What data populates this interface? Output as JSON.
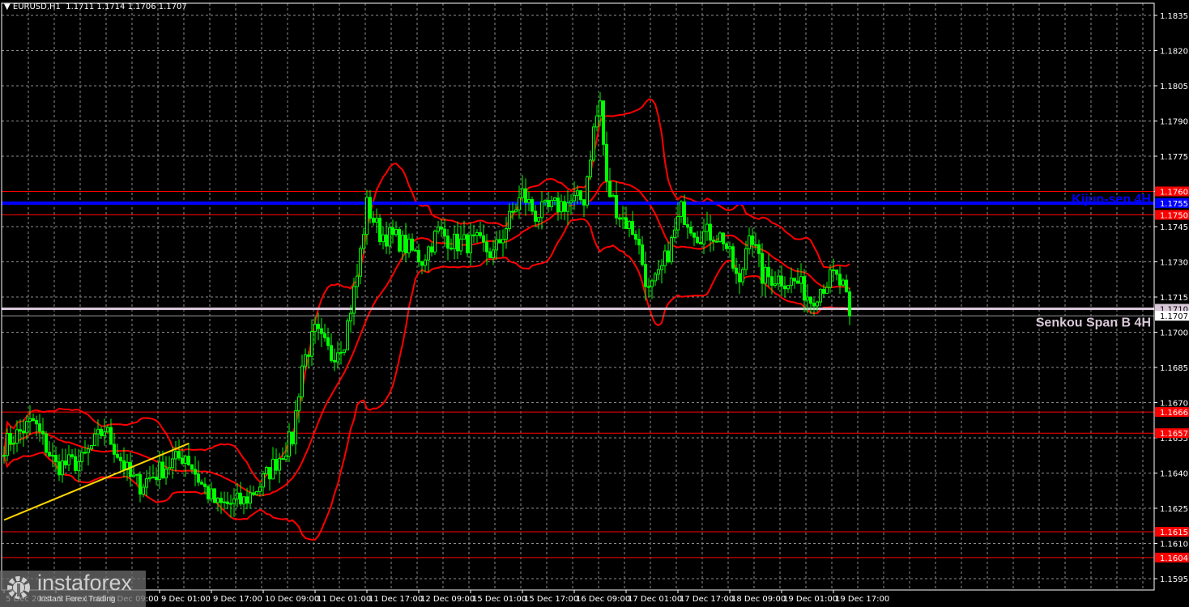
{
  "header": {
    "symbol": "EURUSD,H1",
    "ohlc": "1.1711 1.1714 1.1706 1.1707"
  },
  "watermark": {
    "brand": "instaforex",
    "tagline": "Instant Forex Trading"
  },
  "colors": {
    "candle": "#00ff00",
    "bands": "#ff0000",
    "kijun": "#0000ff",
    "senkou": "#d8c8d8",
    "trend": "#ffd700",
    "grid": "#8c8c8c"
  },
  "chart_data": {
    "type": "candlestick",
    "title": "EURUSD,H1",
    "ylim": [
      1.1588,
      1.1842
    ],
    "y_ticks": [
      1.1835,
      1.182,
      1.1805,
      1.179,
      1.1775,
      1.176,
      1.1745,
      1.173,
      1.1715,
      1.17,
      1.1685,
      1.167,
      1.1655,
      1.164,
      1.1625,
      1.161,
      1.1595
    ],
    "x_ticks": [
      {
        "bar": 0,
        "label": "5 Dec 2025"
      },
      {
        "bar": 16,
        "label": "5 Dec 17:00"
      },
      {
        "bar": 32,
        "label": "8 Dec 09:00"
      },
      {
        "bar": 48,
        "label": "9 Dec 01:00"
      },
      {
        "bar": 64,
        "label": "9 Dec 17:00"
      },
      {
        "bar": 80,
        "label": "10 Dec 09:00"
      },
      {
        "bar": 96,
        "label": "11 Dec 01:00"
      },
      {
        "bar": 112,
        "label": "11 Dec 17:00"
      },
      {
        "bar": 128,
        "label": "12 Dec 09:00"
      },
      {
        "bar": 144,
        "label": "15 Dec 01:00"
      },
      {
        "bar": 160,
        "label": "15 Dec 17:00"
      },
      {
        "bar": 176,
        "label": "16 Dec 09:00"
      },
      {
        "bar": 192,
        "label": "17 Dec 01:00"
      },
      {
        "bar": 208,
        "label": "17 Dec 17:00"
      },
      {
        "bar": 224,
        "label": "18 Dec 09:00"
      },
      {
        "bar": 240,
        "label": "19 Dec 01:00"
      },
      {
        "bar": 256,
        "label": "19 Dec 17:00"
      }
    ],
    "close_path": [
      [
        0,
        1.1652
      ],
      [
        9,
        1.1662
      ],
      [
        16,
        1.1643
      ],
      [
        24,
        1.1645
      ],
      [
        31,
        1.1659
      ],
      [
        39,
        1.1638
      ],
      [
        42,
        1.1635
      ],
      [
        49,
        1.1642
      ],
      [
        56,
        1.1648
      ],
      [
        61,
        1.1635
      ],
      [
        66,
        1.1626
      ],
      [
        74,
        1.1628
      ],
      [
        79,
        1.1635
      ],
      [
        84,
        1.1645
      ],
      [
        89,
        1.1655
      ],
      [
        92,
        1.1686
      ],
      [
        96,
        1.17
      ],
      [
        101,
        1.169
      ],
      [
        105,
        1.1697
      ],
      [
        109,
        1.1724
      ],
      [
        112,
        1.1754
      ],
      [
        116,
        1.1742
      ],
      [
        121,
        1.174
      ],
      [
        129,
        1.1731
      ],
      [
        134,
        1.1743
      ],
      [
        139,
        1.1738
      ],
      [
        146,
        1.1738
      ],
      [
        151,
        1.1733
      ],
      [
        156,
        1.1748
      ],
      [
        160,
        1.1759
      ],
      [
        164,
        1.175
      ],
      [
        171,
        1.1754
      ],
      [
        179,
        1.1757
      ],
      [
        182,
        1.1786
      ],
      [
        184,
        1.1798
      ],
      [
        186,
        1.1762
      ],
      [
        190,
        1.175
      ],
      [
        195,
        1.1742
      ],
      [
        199,
        1.1717
      ],
      [
        202,
        1.1723
      ],
      [
        206,
        1.1738
      ],
      [
        209,
        1.1752
      ],
      [
        214,
        1.1742
      ],
      [
        219,
        1.1742
      ],
      [
        222,
        1.174
      ],
      [
        225,
        1.1728
      ],
      [
        227,
        1.1719
      ],
      [
        230,
        1.1745
      ],
      [
        234,
        1.1724
      ],
      [
        239,
        1.1723
      ],
      [
        245,
        1.1721
      ],
      [
        249,
        1.1714
      ],
      [
        252,
        1.1719
      ],
      [
        256,
        1.1724
      ],
      [
        259,
        1.1719
      ],
      [
        261,
        1.1707
      ]
    ],
    "levels": [
      {
        "price": 1.176,
        "label": "1.1760",
        "kind": "resistance"
      },
      {
        "price": 1.1755,
        "label": "1.1755",
        "kind": "kijun",
        "name": "Kijun-sen 4H"
      },
      {
        "price": 1.175,
        "label": "1.1750",
        "kind": "resistance"
      },
      {
        "price": 1.171,
        "label": "1.1710",
        "kind": "senkou",
        "name": "Senkou Span B 4H"
      },
      {
        "price": 1.1707,
        "label": "1.1707",
        "kind": "bid"
      },
      {
        "price": 1.1666,
        "label": "1.1666",
        "kind": "support"
      },
      {
        "price": 1.1657,
        "label": "1.1657",
        "kind": "support"
      },
      {
        "price": 1.1615,
        "label": "1.1615",
        "kind": "support"
      },
      {
        "price": 1.1604,
        "label": "1.1604",
        "kind": "support"
      }
    ],
    "trendline": {
      "from": [
        0,
        1.162
      ],
      "to": [
        57,
        1.16526
      ]
    }
  }
}
